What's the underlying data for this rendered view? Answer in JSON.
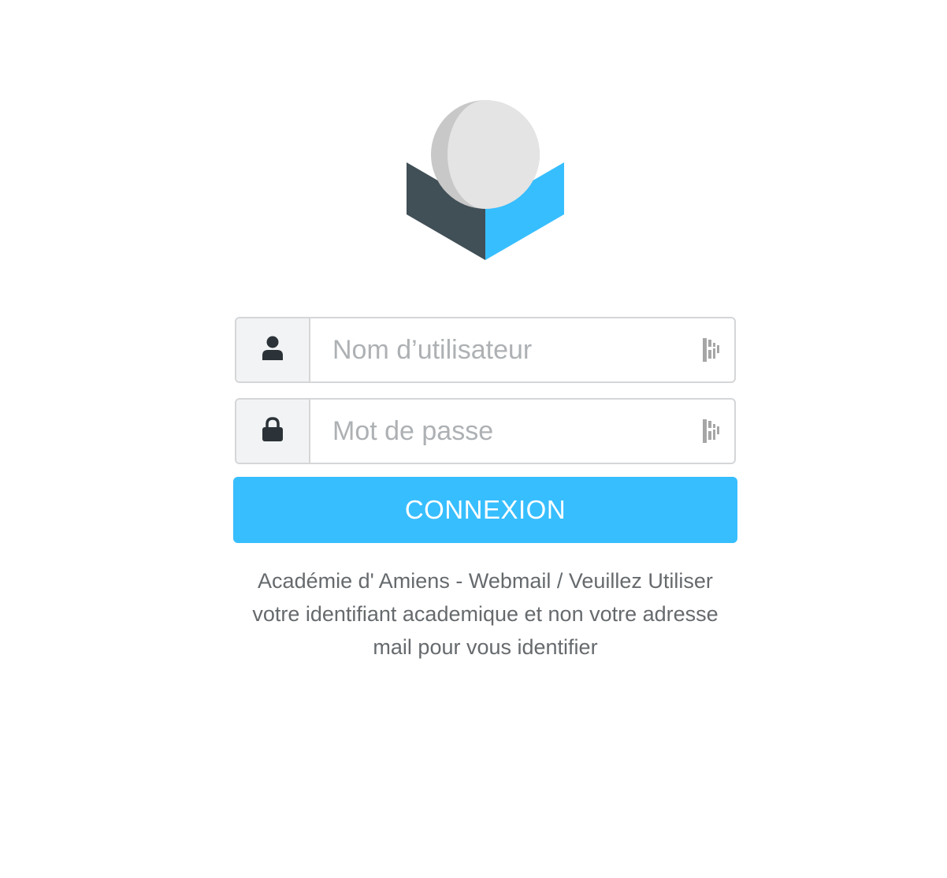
{
  "login": {
    "username_placeholder": "Nom d’utilisateur",
    "username_value": "",
    "password_placeholder": "Mot de passe",
    "password_value": "",
    "submit_label": "CONNEXION",
    "notice_lines": [
      "Académie d' Amiens - Webmail / Veuillez Utiliser",
      "votre identifiant academique et non votre adresse",
      "mail pour vous identifier"
    ]
  },
  "icons": {
    "logo": "roundcube-logo",
    "username": "user-icon",
    "password": "lock-icon",
    "password_manager": "password-manager-icon"
  },
  "colors": {
    "accent": "#37beff",
    "box_dark": "#414f57",
    "sphere_light": "#e4e4e4",
    "sphere_shadow": "#c8c8c8",
    "addon_background": "#f1f3f4",
    "border": "#d4d6d8",
    "placeholder": "#aeb1b4",
    "notice_text": "#666a6d"
  }
}
